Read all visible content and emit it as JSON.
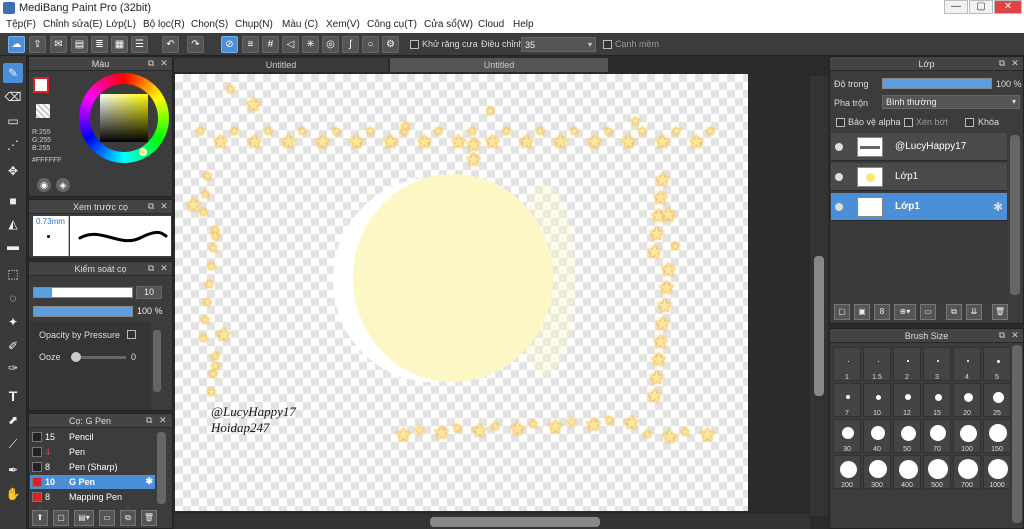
{
  "window": {
    "title": "MediBang Paint Pro (32bit)",
    "min": "—",
    "max": "▢",
    "close": "✕"
  },
  "menu": [
    "Tệp(F)",
    "Chỉnh sửa(E)",
    "Lớp(L)",
    "Bộ lọc(R)",
    "Chọn(S)",
    "Chụp(N)",
    "Màu (C)",
    "Xem(V)",
    "Công cụ(T)",
    "Cửa sổ(W)",
    "Cloud",
    "Help"
  ],
  "toolbar": {
    "antialias_label": "Khử răng cưa",
    "adjust_label": "Điều chỉnh",
    "adjust_value": "35",
    "edge_label": "Cạnh mềm"
  },
  "color_panel": {
    "title": "Màu",
    "r": "R:255",
    "g": "G:255",
    "b": "B:255",
    "hex": "#FFFFFF",
    "primary_color": "#ffffff",
    "accent": "#e02020"
  },
  "preview_panel": {
    "title": "Xem trước cọ",
    "size": "0.73mm"
  },
  "brush_control": {
    "title": "Kiểm soát cọ",
    "size_value": "10",
    "opacity_value": "100 %",
    "opacity_pressure_label": "Opacity by Pressure",
    "ooze_label": "Ooze",
    "ooze_value": "0"
  },
  "brush_list": {
    "title": "Cọ: G Pen",
    "items": [
      {
        "size": "15",
        "name": "Pencil",
        "color": "#222222"
      },
      {
        "size": "4",
        "name": "Pen",
        "color": "#222222"
      },
      {
        "size": "8",
        "name": "Pen (Sharp)",
        "color": "#222222"
      },
      {
        "size": "10",
        "name": "G Pen",
        "color": "#e02020",
        "selected": true
      },
      {
        "size": "8",
        "name": "Mapping Pen",
        "color": "#e02020"
      }
    ]
  },
  "tabs": [
    "Untitled",
    "Untitled"
  ],
  "canvas_text": {
    "line1": "@LucyHappy17",
    "line2": "Hoidap247"
  },
  "layer_panel": {
    "title": "Lớp",
    "opacity_label": "Độ trong",
    "opacity_value": "100 %",
    "blend_label": "Pha trộn",
    "blend_value": "Bình thường",
    "protect_alpha": "Bảo vệ alpha",
    "clip": "Xén bớt",
    "lock": "Khóa",
    "layers": [
      {
        "name": "@LucyHappy17"
      },
      {
        "name": "Lớp1"
      },
      {
        "name": "Lớp1",
        "selected": true
      }
    ]
  },
  "brush_size_panel": {
    "title": "Brush Size",
    "sizes": [
      "1",
      "1.5",
      "2",
      "3",
      "4",
      "5",
      "7",
      "10",
      "12",
      "15",
      "20",
      "25",
      "30",
      "40",
      "50",
      "70",
      "100",
      "150",
      "200",
      "300",
      "400",
      "500",
      "700",
      "1000"
    ]
  }
}
